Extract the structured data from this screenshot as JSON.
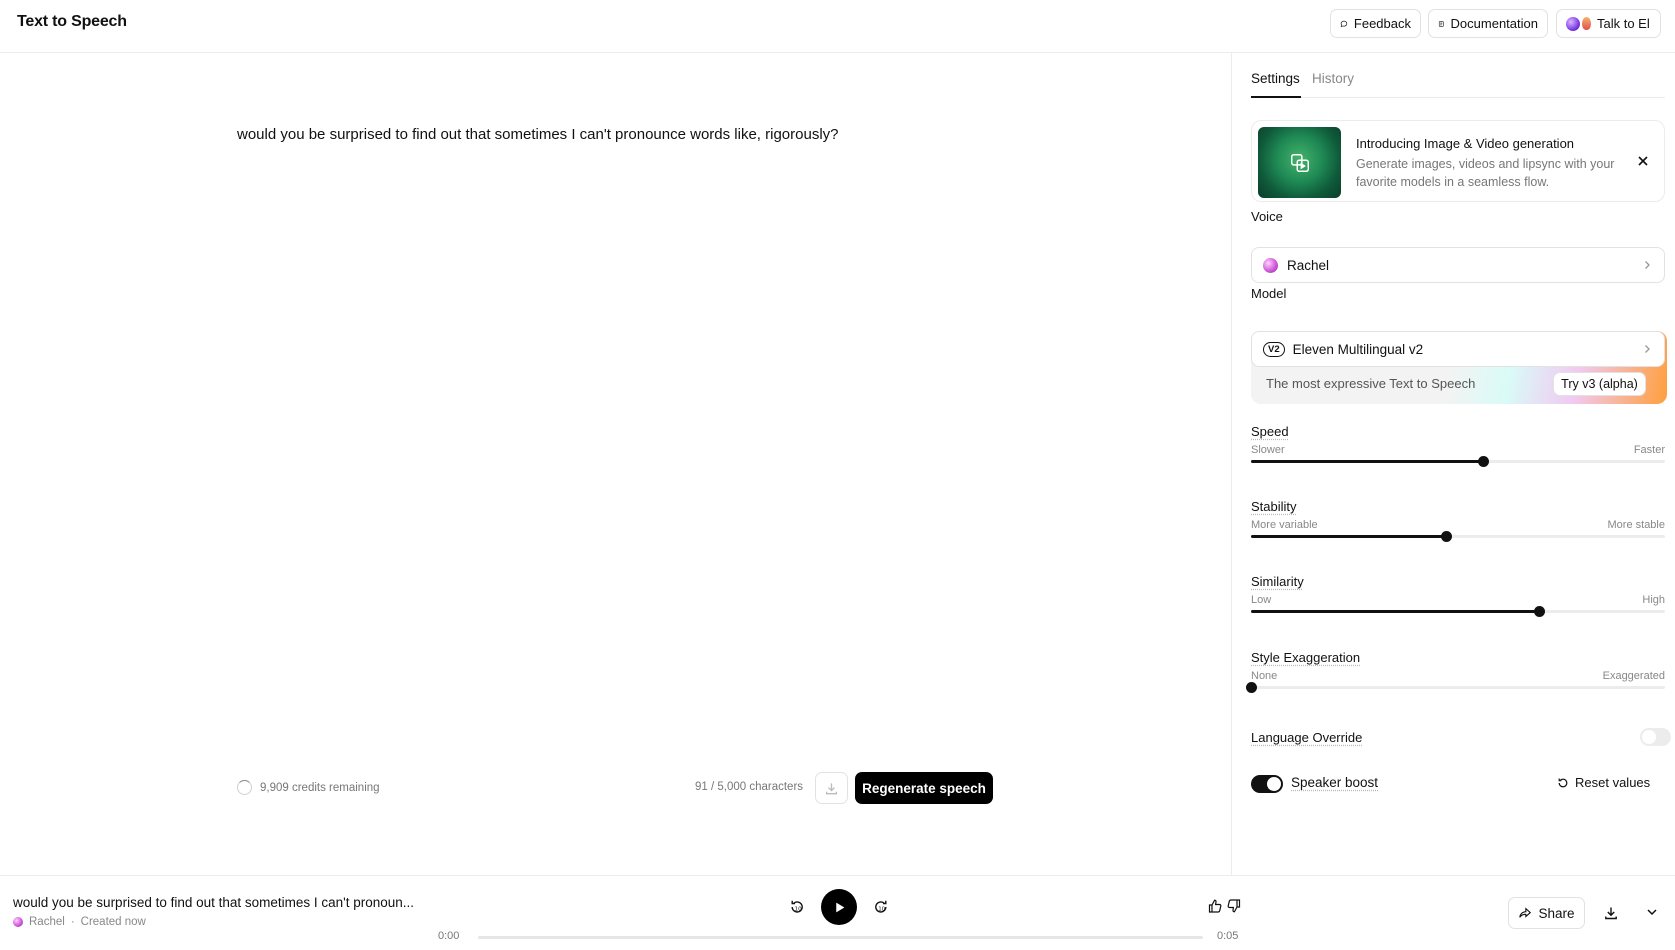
{
  "header": {
    "title": "Text to Speech",
    "feedback_label": "Feedback",
    "documentation_label": "Documentation",
    "talk_label": "Talk to El"
  },
  "editor": {
    "text": "would you be surprised to find out that sometimes I can't pronounce words like, rigorously?",
    "credits": "9,909 credits remaining",
    "char_count": "91 / 5,000 characters",
    "regenerate_label": "Regenerate speech"
  },
  "panel": {
    "tabs": [
      {
        "label": "Settings",
        "active": true
      },
      {
        "label": "History",
        "active": false
      }
    ],
    "promo": {
      "title": "Introducing Image & Video generation",
      "description": "Generate images, videos and lipsync with your favorite models in a seamless flow."
    },
    "voice": {
      "label": "Voice",
      "value": "Rachel"
    },
    "model": {
      "label": "Model",
      "badge": "V2",
      "value": "Eleven Multilingual v2",
      "caption": "The most expressive Text to Speech",
      "try_label": "Try v3 (alpha)"
    },
    "sliders": [
      {
        "title": "Speed",
        "min_label": "Slower",
        "max_label": "Faster",
        "value": 0.56
      },
      {
        "title": "Stability",
        "min_label": "More variable",
        "max_label": "More stable",
        "value": 0.47
      },
      {
        "title": "Similarity",
        "min_label": "Low",
        "max_label": "High",
        "value": 0.695
      },
      {
        "title": "Style Exaggeration",
        "min_label": "None",
        "max_label": "Exaggerated",
        "value": 0.0
      }
    ],
    "language_override": {
      "label": "Language Override",
      "enabled": false
    },
    "speaker_boost": {
      "label": "Speaker boost",
      "enabled": true
    },
    "reset_label": "Reset values"
  },
  "player": {
    "title": "would you be surprised to find out that sometimes I can't pronoun...",
    "voice": "Rachel",
    "created": "Created now",
    "time_current": "0:00",
    "time_total": "0:05",
    "progress": 0.0,
    "share_label": "Share"
  },
  "colors": {
    "accent": "#000000",
    "border": "#e2e2e2",
    "muted_text": "#777777"
  }
}
